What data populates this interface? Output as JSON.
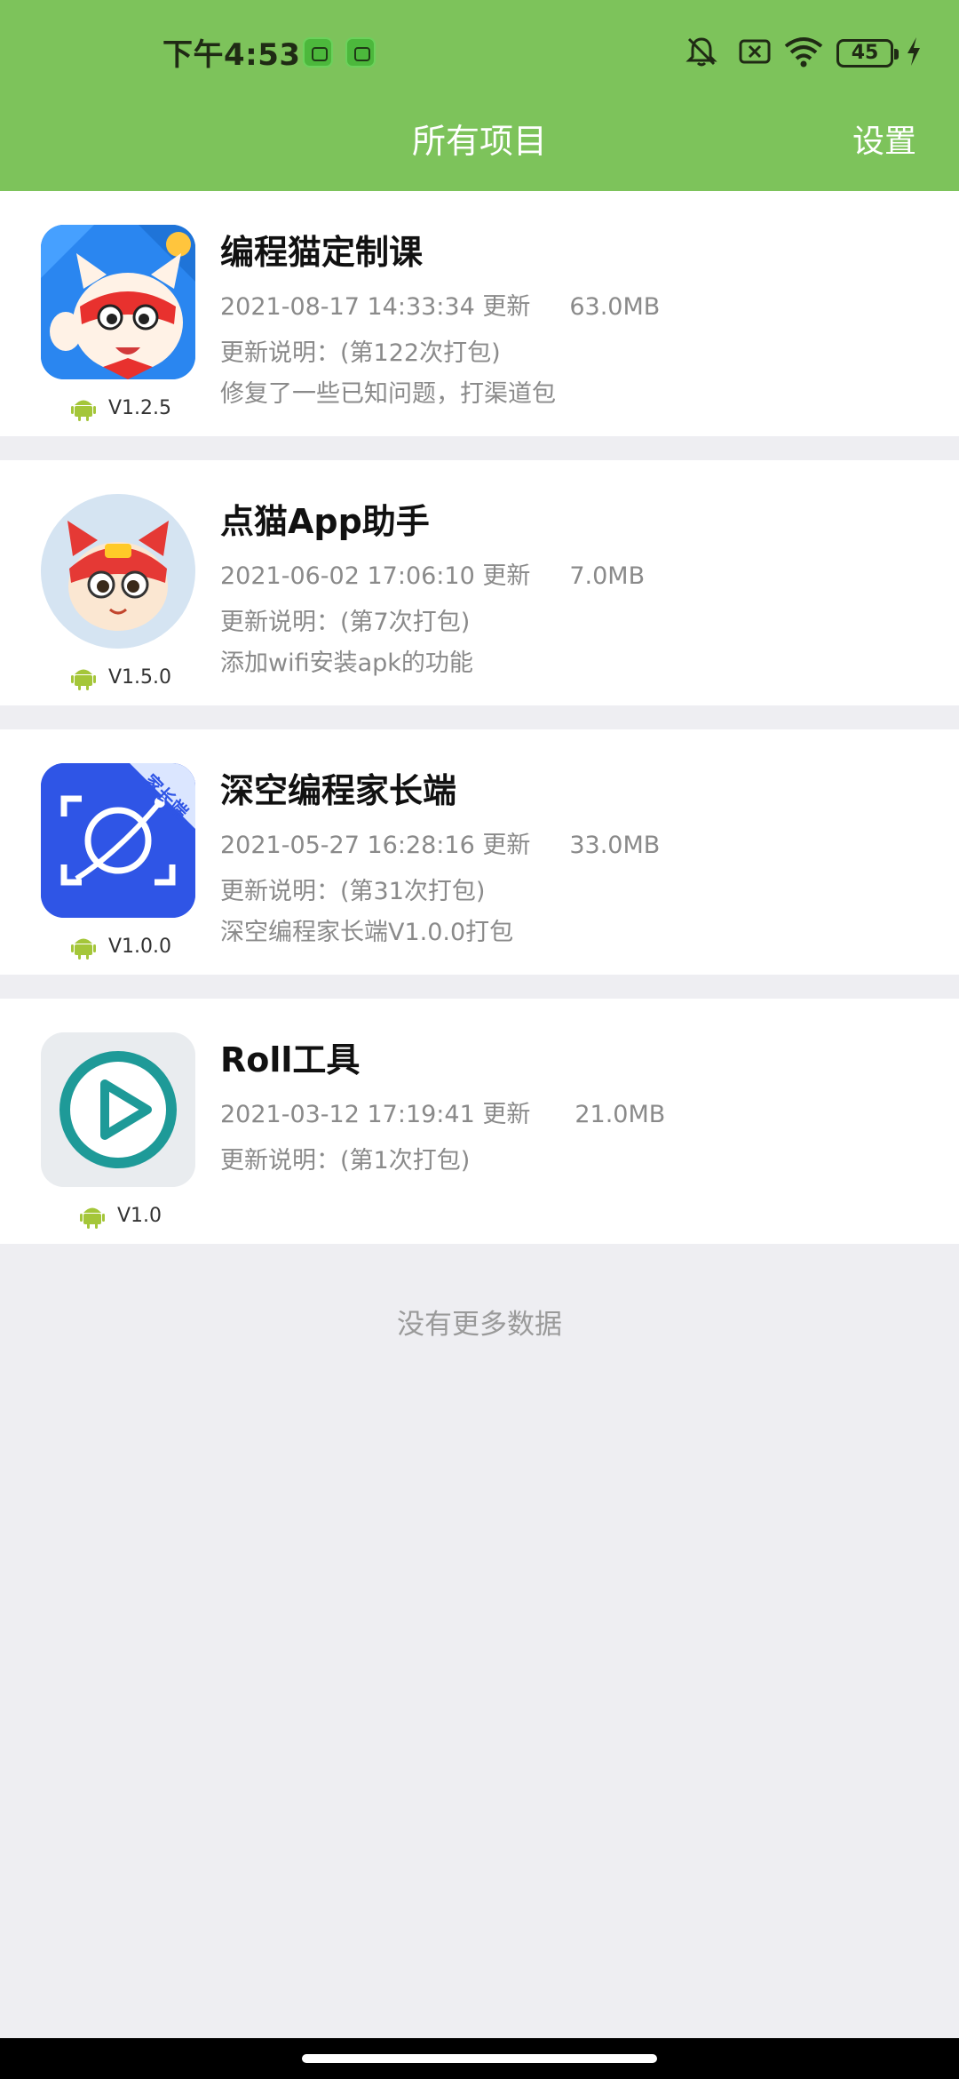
{
  "status_bar": {
    "time": "下午4:53",
    "battery": "45"
  },
  "header": {
    "title": "所有项目",
    "settings_label": "设置"
  },
  "projects": [
    {
      "name": "编程猫定制课",
      "version": "V1.2.5",
      "updated": "2021-08-17 14:33:34 更新",
      "size": "63.0MB",
      "note_title": "更新说明：(第122次打包)",
      "note_detail": "修复了一些已知问题，打渠道包",
      "icon": "codemao-custom-course-icon"
    },
    {
      "name": "点猫App助手",
      "version": "V1.5.0",
      "updated": "2021-06-02 17:06:10 更新",
      "size": "7.0MB",
      "note_title": "更新说明：(第7次打包)",
      "note_detail": "添加wifi安装apk的功能",
      "icon": "dianmao-assistant-icon"
    },
    {
      "name": "深空编程家长端",
      "version": "V1.0.0",
      "updated": "2021-05-27 16:28:16 更新",
      "size": "33.0MB",
      "note_title": "更新说明：(第31次打包)",
      "note_detail": "深空编程家长端V1.0.0打包",
      "icon": "deepspace-parent-icon",
      "icon_badge": "家长端"
    },
    {
      "name": "Roll工具",
      "version": "V1.0",
      "updated": "2021-03-12 17:19:41 更新",
      "size": "21.0MB",
      "note_title": "更新说明：(第1次打包)",
      "note_detail": "",
      "icon": "roll-tool-play-icon"
    }
  ],
  "footer": {
    "no_more": "没有更多数据"
  },
  "colors": {
    "header_bg": "#7dc35b",
    "android_green": "#a4c639",
    "page_bg": "#eeeef2"
  }
}
